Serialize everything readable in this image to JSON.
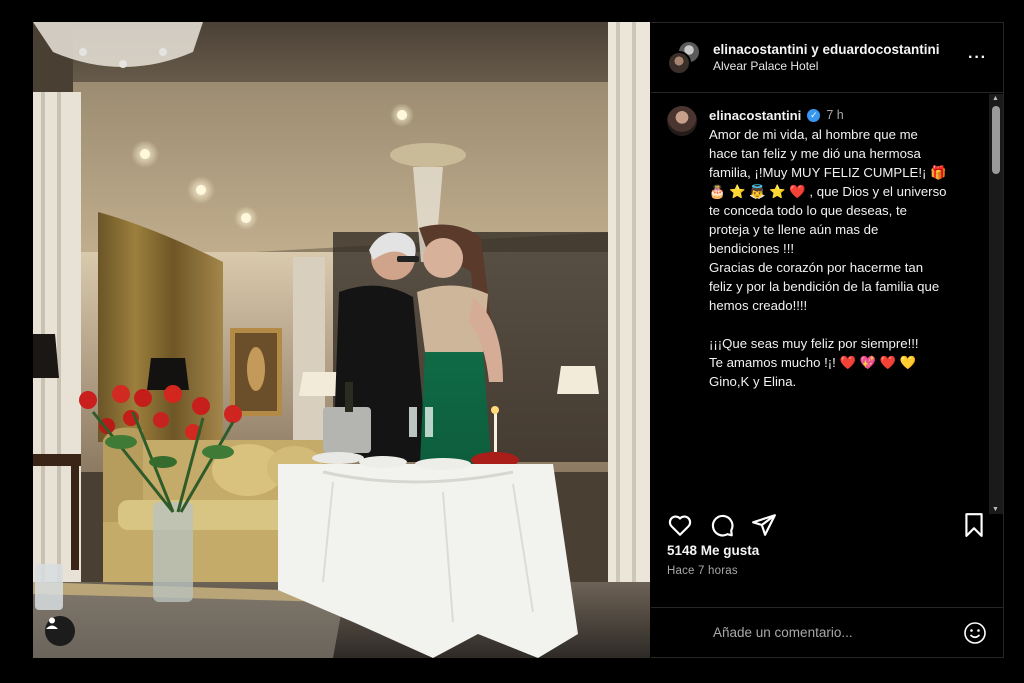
{
  "post": {
    "header": {
      "usernames": "elinacostantini y eduardocostantini",
      "location": "Alvear Palace Hotel",
      "more_icon": "more-options-icon"
    },
    "caption": {
      "username": "elinacostantini",
      "verified": true,
      "time": "7 h",
      "lines": [
        "Amor de mi vida, al hombre que me",
        "hace tan feliz y me dió una hermosa",
        "familia, ¡!Muy MUY FELIZ CUMPLE!¡ 🎁",
        "🎂 ⭐ 👼 ⭐ ❤️ , que Dios y el universo",
        "te conceda todo lo que deseas, te",
        "proteja y te llene aún mas de",
        "bendiciones !!!",
        "Gracias de corazón por hacerme tan",
        "feliz y por la bendición de la familia que",
        "hemos creado!!!!",
        "",
        "¡¡¡Que seas muy feliz por siempre!!!",
        "Te amamos mucho !¡! ❤️ 💖 ❤️ 💛",
        "Gino,K y Elina."
      ]
    },
    "likes": "5148 Me gusta",
    "timestamp": "Hace 7 horas",
    "comment_placeholder": "Añade un comentario...",
    "icons": [
      "heart-icon",
      "comment-icon",
      "share-icon",
      "bookmark-icon",
      "emoji-icon",
      "user-tag-icon"
    ],
    "colors": {
      "background": "#000000",
      "verified": "#3897f0",
      "secondary_text": "#a8a8a8"
    }
  }
}
